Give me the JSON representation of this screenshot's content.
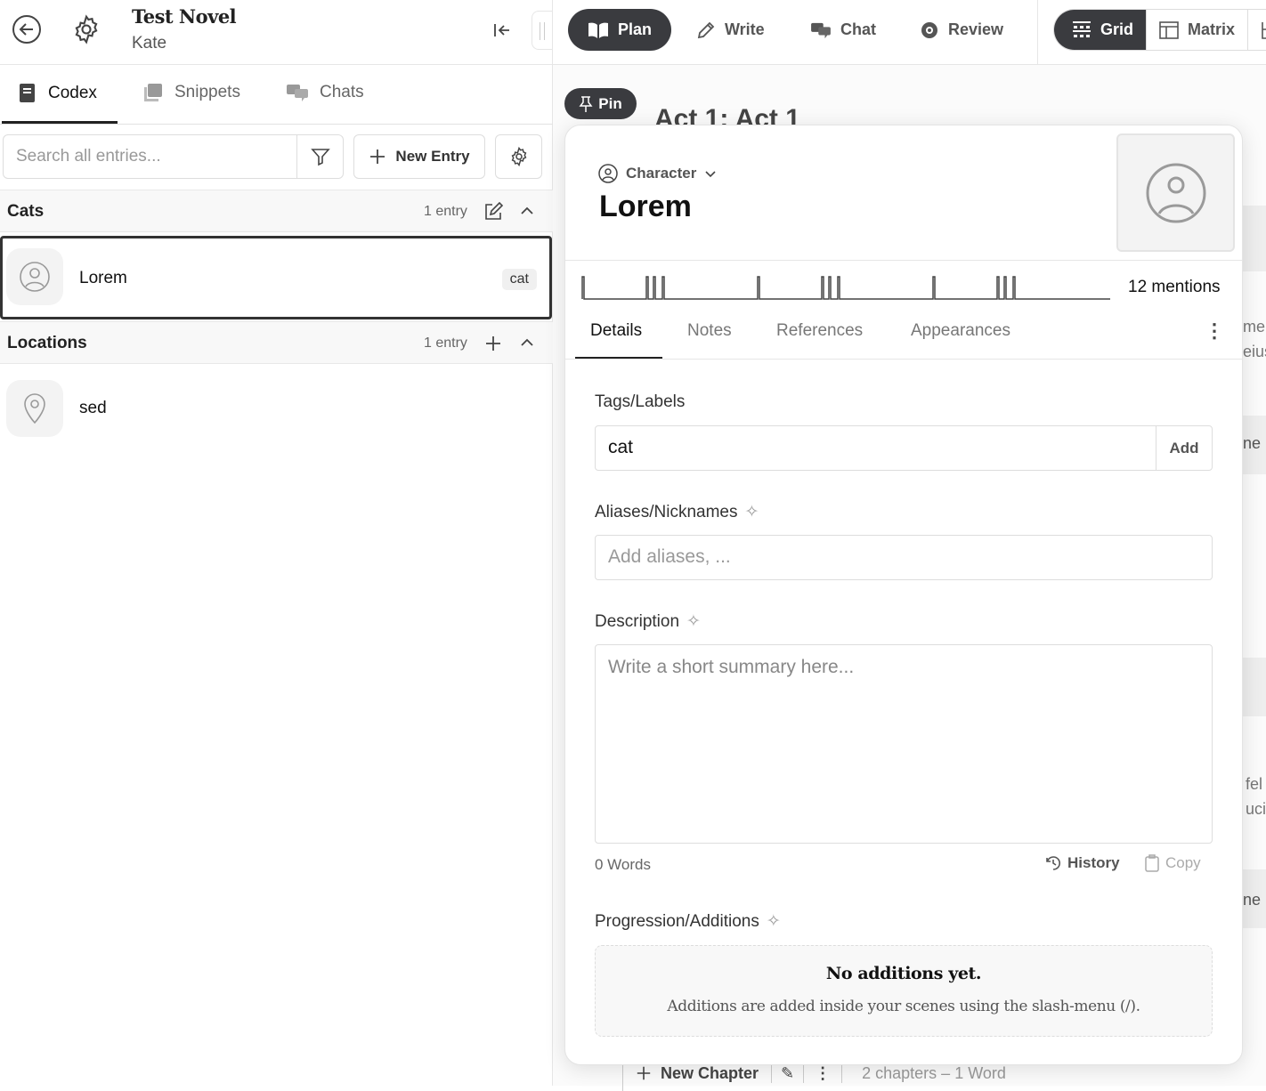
{
  "project": {
    "title": "Test Novel",
    "author": "Kate"
  },
  "left_tabs": [
    {
      "label": "Codex",
      "icon": "book-icon"
    },
    {
      "label": "Snippets",
      "icon": "snippets-icon"
    },
    {
      "label": "Chats",
      "icon": "chat-icon"
    }
  ],
  "search": {
    "placeholder": "Search all entries...",
    "value": ""
  },
  "new_entry_label": "New Entry",
  "groups": [
    {
      "name": "Cats",
      "count": "1 entry",
      "entries": [
        {
          "name": "Lorem",
          "tag": "cat",
          "icon": "person-icon",
          "selected": true
        }
      ]
    },
    {
      "name": "Locations",
      "count": "1 entry",
      "entries": [
        {
          "name": "sed",
          "icon": "map-pin-icon"
        }
      ]
    }
  ],
  "modes": [
    {
      "label": "Plan",
      "active": true
    },
    {
      "label": "Write"
    },
    {
      "label": "Chat"
    },
    {
      "label": "Review"
    }
  ],
  "views": [
    {
      "label": "Grid",
      "active": true
    },
    {
      "label": "Matrix"
    }
  ],
  "background": {
    "act_title": "Act 1: Act 1",
    "pin_label": "Pin",
    "new_chapter": "New Chapter",
    "stats": "2 chapters  –  1 Word",
    "edge_fragments": [
      "me",
      "eius",
      "ne",
      "fel",
      "uci",
      "ne"
    ]
  },
  "entry": {
    "type": "Character",
    "name": "Lorem",
    "mentions": "12 mentions",
    "tabs": [
      "Details",
      "Notes",
      "References",
      "Appearances"
    ],
    "tags_label": "Tags/Labels",
    "tag_value": "cat",
    "add_label": "Add",
    "aliases_label": "Aliases/Nicknames",
    "aliases_placeholder": "Add aliases, ...",
    "description_label": "Description",
    "description_placeholder": "Write a short summary here...",
    "word_count": "0 Words",
    "history_label": "History",
    "copy_label": "Copy",
    "progression_label": "Progression/Additions",
    "empty_title": "No additions yet.",
    "empty_text": "Additions are added inside your scenes using the slash-menu (/)."
  },
  "colors": {
    "dark": "#3a3b3f",
    "border": "#dddddd",
    "muted": "#777777"
  }
}
